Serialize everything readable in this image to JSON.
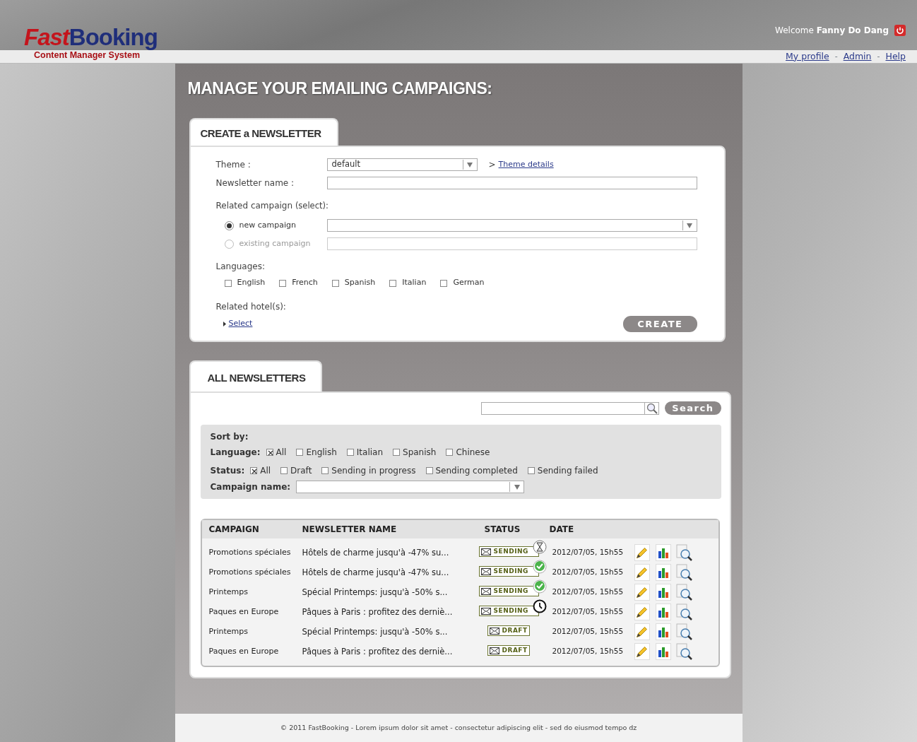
{
  "header": {
    "logo": {
      "first": "Fast",
      "second": "Booking",
      "subtitle": "Content Manager System"
    },
    "welcome": {
      "prefix": "Welcome",
      "user": "Fanny Do Dang"
    },
    "nav": [
      {
        "kind": "link",
        "text": "My profile"
      },
      {
        "kind": "separator",
        "text": "-"
      },
      {
        "kind": "link",
        "text": "Admin"
      },
      {
        "kind": "separator",
        "text": "-"
      },
      {
        "kind": "link",
        "text": "Help"
      }
    ]
  },
  "page_title": "MANAGE YOUR EMAILING CAMPAIGNS:",
  "create_panel": {
    "tab": "CREATE a NEWSLETTER",
    "theme": {
      "label": "Theme :",
      "value": "default",
      "link_prefix": ">",
      "link": "Theme details"
    },
    "newsletter_name": {
      "label": "Newsletter name :"
    },
    "related_campaign": {
      "label": "Related campaign",
      "hint": "(select):",
      "options": [
        {
          "label": "new campaign",
          "selected": true,
          "disabled": false
        },
        {
          "label": "existing campaign",
          "selected": false,
          "disabled": true
        }
      ]
    },
    "languages": {
      "label": "Languages:",
      "options": [
        {
          "label": "English",
          "checked": false
        },
        {
          "label": "French",
          "checked": false
        },
        {
          "label": "Spanish",
          "checked": false
        },
        {
          "label": "Italian",
          "checked": false
        },
        {
          "label": "German",
          "checked": false
        }
      ]
    },
    "related_hotels": {
      "label": "Related hotel(s):",
      "link": "Select"
    },
    "button": "CREATE"
  },
  "list_panel": {
    "tab": "ALL NEWSLETTERS",
    "search_button": "Search",
    "sort": {
      "title": "Sort by:",
      "language": {
        "label": "Language:",
        "options": [
          {
            "label": "All",
            "checked": true
          },
          {
            "label": "English",
            "checked": false
          },
          {
            "label": "Italian",
            "checked": false
          },
          {
            "label": "Spanish",
            "checked": false
          },
          {
            "label": "Chinese",
            "checked": false
          }
        ]
      },
      "status": {
        "label": "Status:",
        "options": [
          {
            "label": "All",
            "checked": true
          },
          {
            "label": "Draft",
            "checked": false
          },
          {
            "label": "Sending in progress",
            "checked": false
          },
          {
            "label": "Sending completed",
            "checked": false
          },
          {
            "label": "Sending failed",
            "checked": false
          }
        ]
      },
      "campaign_name": {
        "label": "Campaign name:"
      }
    },
    "table": {
      "columns": [
        "CAMPAIGN",
        "NEWSLETTER NAME",
        "STATUS",
        "DATE"
      ],
      "rows": [
        {
          "campaign": "Promotions spéciales",
          "name": "Hôtels de charme jusqu'à -47% su...",
          "status": {
            "kind": "sending",
            "label": "SENDING",
            "indicator": {
              "kind": "hourglass"
            }
          },
          "date": "2012/07/05, 15h55"
        },
        {
          "campaign": "Promotions spéciales",
          "name": "Hôtels de charme jusqu'à -47% su...",
          "status": {
            "kind": "sending",
            "label": "SENDING",
            "indicator": {
              "kind": "check"
            }
          },
          "date": "2012/07/05, 15h55"
        },
        {
          "campaign": "Printemps",
          "name": "Spécial Printemps: jusqu'à -50% s...",
          "status": {
            "kind": "sending",
            "label": "SENDING",
            "indicator": {
              "kind": "check"
            }
          },
          "date": "2012/07/05, 15h55"
        },
        {
          "campaign": "Paques en Europe",
          "name": "Pâques à Paris : profitez des derniè...",
          "status": {
            "kind": "sending",
            "label": "SENDING",
            "indicator": {
              "kind": "clock"
            }
          },
          "date": "2012/07/05, 15h55"
        },
        {
          "campaign": "Printemps",
          "name": "Spécial Printemps: jusqu'à -50% s...",
          "status": {
            "kind": "draft",
            "label": "DRAFT"
          },
          "date": "2012/07/05, 15h55"
        },
        {
          "campaign": "Paques en Europe",
          "name": "Pâques à Paris : profitez des derniè...",
          "status": {
            "kind": "draft",
            "label": "DRAFT"
          },
          "date": "2012/07/05, 15h55"
        }
      ]
    }
  },
  "footer": "© 2011 FastBooking - Lorem ipsum dolor sit amet - consectetur adipiscing elit - sed do eiusmod tempo dz"
}
